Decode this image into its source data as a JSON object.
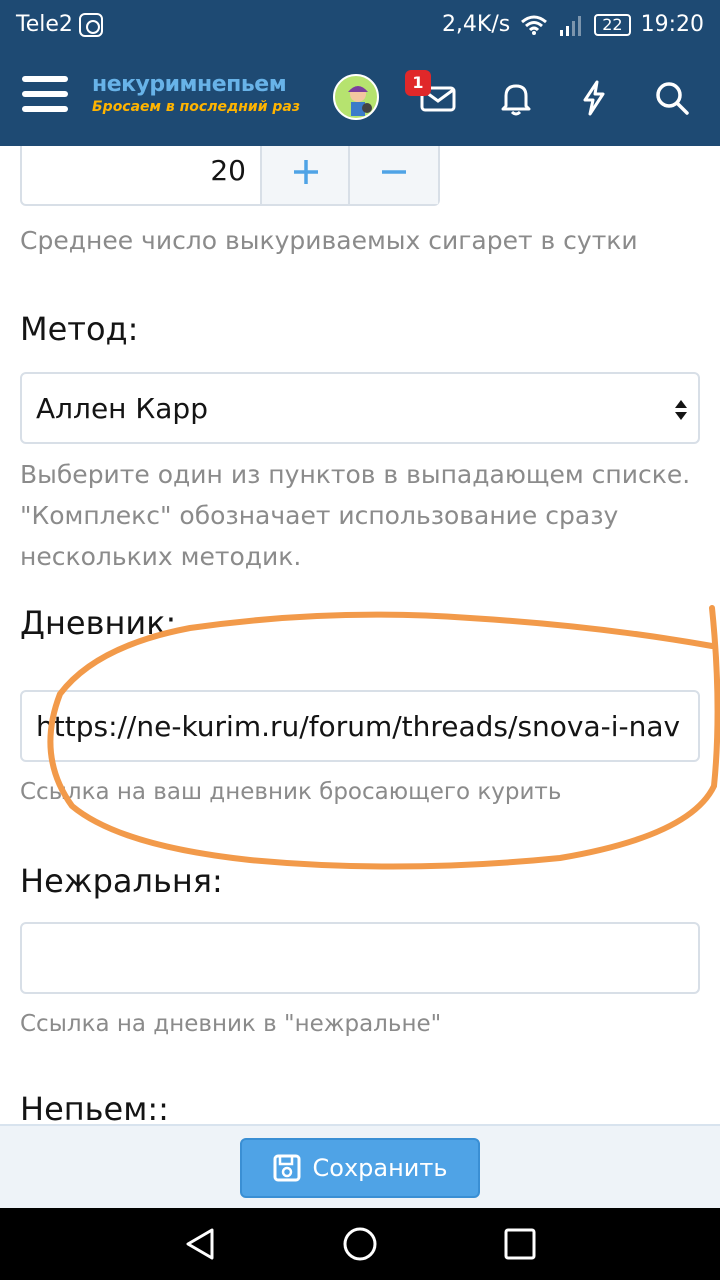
{
  "status_bar": {
    "carrier": "Tele2",
    "speed": "2,4K/s",
    "battery": "22",
    "time": "19:20"
  },
  "header": {
    "logo_title": "некуримнепьем",
    "logo_subtitle": "Бросаем в последний раз",
    "notification_count": "1",
    "colors": {
      "bar": "#1e4a73",
      "logo_blue": "#68b3e8",
      "logo_orange": "#ffb400",
      "badge": "#e0282a"
    }
  },
  "form": {
    "cigarettes": {
      "value": "20",
      "plus_label": "+",
      "minus_label": "−",
      "hint": "Среднее число выкуриваемых сигарет в сутки"
    },
    "method": {
      "label": "Метод:",
      "value": "Аллен Карр",
      "hint": "Выберите один из пунктов в выпадающем списке. \"Комплекс\" обозначает использование сразу нескольких методик."
    },
    "diary": {
      "label": "Дневник:",
      "value": "https://ne-kurim.ru/forum/threads/snova-i-nav",
      "hint": "Ссылка на ваш дневник бросающего курить"
    },
    "nezhralnya": {
      "label": "Нежральня:",
      "value": "",
      "hint": "Ссылка на дневник в \"нежральне\""
    },
    "nepyem": {
      "label": "Непьем::"
    }
  },
  "footer": {
    "save_label": "Сохранить",
    "accent": "#4fa3e6"
  },
  "annotation": {
    "color": "#f29a4a"
  }
}
